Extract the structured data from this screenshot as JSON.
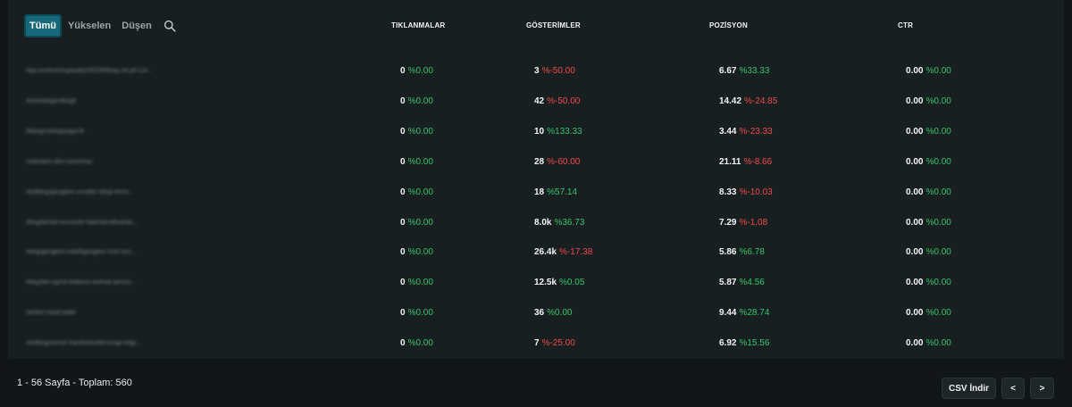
{
  "filters": {
    "tabs": [
      "Tümü",
      "Yükselen",
      "Düşen"
    ],
    "active": "Tümü"
  },
  "columns": {
    "clicks": "TIKLANMALAR",
    "impressions": "GÖSTERİMLER",
    "position": "POZİSYON",
    "ctr": "CTR"
  },
  "rows": [
    {
      "page": "hbp-contents/uploads/2023/08/aq-2A.jfif-CA...",
      "clicks": {
        "value": "0",
        "change": "%0.00",
        "dir": "pos"
      },
      "impressions": {
        "value": "3",
        "change": "%-50.00",
        "dir": "neg"
      },
      "position": {
        "value": "6.67",
        "change": "%33.33",
        "dir": "pos"
      },
      "ctr": {
        "value": "0.00",
        "change": "%0.00",
        "dir": "pos"
      }
    },
    {
      "page": "/kmfsdsbgm/blogl/",
      "clicks": {
        "value": "0",
        "change": "%0.00",
        "dir": "pos"
      },
      "impressions": {
        "value": "42",
        "change": "%-50.00",
        "dir": "neg"
      },
      "position": {
        "value": "14.42",
        "change": "%-24.85",
        "dir": "neg"
      },
      "ctr": {
        "value": "0.00",
        "change": "%0.00",
        "dir": "pos"
      }
    },
    {
      "page": "/fbdsgm/blog/page/3/",
      "clicks": {
        "value": "0",
        "change": "%0.00",
        "dir": "pos"
      },
      "impressions": {
        "value": "10",
        "change": "%133.33",
        "dir": "pos"
      },
      "position": {
        "value": "3.44",
        "change": "%-23.33",
        "dir": "neg"
      },
      "ctr": {
        "value": "0.00",
        "change": "%0.00",
        "dir": "pos"
      }
    },
    {
      "page": "/sobsrpm-sbn-ronunma/",
      "clicks": {
        "value": "0",
        "change": "%0.00",
        "dir": "pos"
      },
      "impressions": {
        "value": "28",
        "change": "%-60.00",
        "dir": "neg"
      },
      "position": {
        "value": "21.11",
        "change": "%-8.66",
        "dir": "neg"
      },
      "ctr": {
        "value": "0.00",
        "change": "%0.00",
        "dir": "pos"
      }
    },
    {
      "page": "/ardblog/gangbon-ucvdter-blogi-termi...",
      "clicks": {
        "value": "0",
        "change": "%0.00",
        "dir": "pos"
      },
      "impressions": {
        "value": "18",
        "change": "%57.14",
        "dir": "pos"
      },
      "position": {
        "value": "8.33",
        "change": "%-10.03",
        "dir": "neg"
      },
      "ctr": {
        "value": "0.00",
        "change": "%0.00",
        "dir": "pos"
      }
    },
    {
      "page": "/blog/bende-kumurler-bakrilan/dtsambi...",
      "clicks": {
        "value": "0",
        "change": "%0.00",
        "dir": "pos"
      },
      "impressions": {
        "value": "8.0k",
        "change": "%36.73",
        "dir": "pos"
      },
      "position": {
        "value": "7.29",
        "change": "%-1.08",
        "dir": "neg"
      },
      "ctr": {
        "value": "0.00",
        "change": "%0.00",
        "dir": "pos"
      }
    },
    {
      "page": "/blog/gangbon-ksbl/fgangbon-tnot-oss...",
      "clicks": {
        "value": "0",
        "change": "%0.00",
        "dir": "pos"
      },
      "impressions": {
        "value": "26.4k",
        "change": "%-17.38",
        "dir": "neg"
      },
      "position": {
        "value": "5.86",
        "change": "%6.78",
        "dir": "pos"
      },
      "ctr": {
        "value": "0.00",
        "change": "%0.00",
        "dir": "pos"
      }
    },
    {
      "page": "/blog/bel-ogrist-tedavisi-astmal-iqnrssi...",
      "clicks": {
        "value": "0",
        "change": "%0.00",
        "dir": "pos"
      },
      "impressions": {
        "value": "12.5k",
        "change": "%0.05",
        "dir": "pos"
      },
      "position": {
        "value": "5.87",
        "change": "%4.56",
        "dir": "pos"
      },
      "ctr": {
        "value": "0.00",
        "change": "%0.00",
        "dir": "pos"
      }
    },
    {
      "page": "/ambm-basit-pabi/",
      "clicks": {
        "value": "0",
        "change": "%0.00",
        "dir": "pos"
      },
      "impressions": {
        "value": "36",
        "change": "%0.00",
        "dir": "pos"
      },
      "position": {
        "value": "9.44",
        "change": "%28.74",
        "dir": "pos"
      },
      "ctr": {
        "value": "0.00",
        "change": "%0.00",
        "dir": "pos"
      }
    },
    {
      "page": "/ardblog/semel-frambodu/blimunge-bilgi...",
      "clicks": {
        "value": "0",
        "change": "%0.00",
        "dir": "pos"
      },
      "impressions": {
        "value": "7",
        "change": "%-25.00",
        "dir": "neg"
      },
      "position": {
        "value": "6.92",
        "change": "%15.56",
        "dir": "pos"
      },
      "ctr": {
        "value": "0.00",
        "change": "%0.00",
        "dir": "pos"
      }
    }
  ],
  "footer": {
    "pagination_text": "1 - 56 Sayfa - Toplam: 560",
    "csv_label": "CSV İndir",
    "prev_label": "<",
    "next_label": ">"
  },
  "colors": {
    "positive": "#34c46a",
    "negative": "#ef4a4a",
    "active_tab": "#17687a",
    "background": "#111618"
  },
  "icons": {
    "search": "search-icon"
  }
}
